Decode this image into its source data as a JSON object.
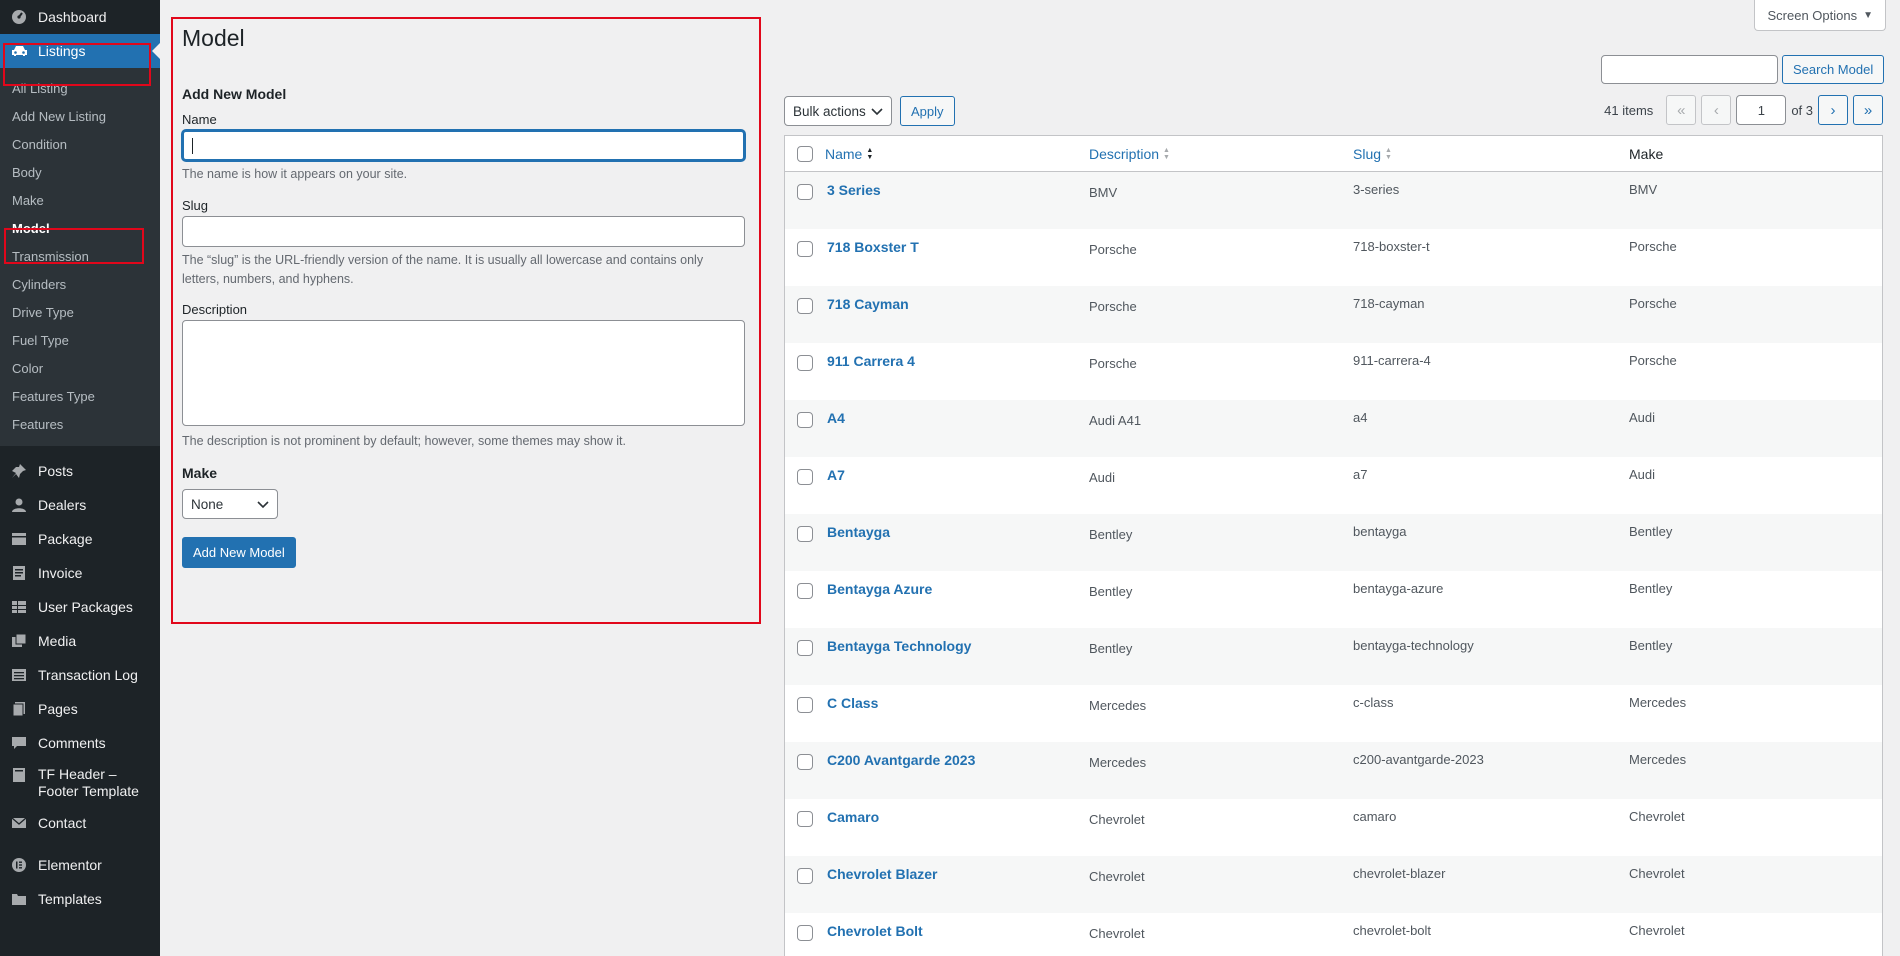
{
  "sidebar": {
    "top_items": [
      {
        "label": "Dashboard",
        "icon": "dashboard-icon"
      },
      {
        "label": "Listings",
        "icon": "car-icon"
      }
    ],
    "submenu": [
      "All Listing",
      "Add New Listing",
      "Condition",
      "Body",
      "Make",
      "Model",
      "Transmission",
      "Cylinders",
      "Drive Type",
      "Fuel Type",
      "Color",
      "Features Type",
      "Features"
    ],
    "bottom_items": [
      {
        "label": "Posts",
        "icon": "pin-icon"
      },
      {
        "label": "Dealers",
        "icon": "user-icon"
      },
      {
        "label": "Package",
        "icon": "package-icon"
      },
      {
        "label": "Invoice",
        "icon": "invoice-icon"
      },
      {
        "label": "User Packages",
        "icon": "table-icon"
      },
      {
        "label": "Media",
        "icon": "media-icon"
      },
      {
        "label": "Transaction Log",
        "icon": "list-icon"
      },
      {
        "label": "Pages",
        "icon": "pages-icon"
      },
      {
        "label": "Comments",
        "icon": "comment-icon"
      },
      {
        "label": "TF Header – Footer Template",
        "icon": "template-icon"
      },
      {
        "label": "Contact",
        "icon": "mail-icon"
      },
      {
        "label": "Elementor",
        "icon": "elementor-icon"
      },
      {
        "label": "Templates",
        "icon": "folder-icon"
      }
    ]
  },
  "screen_options": "Screen Options",
  "form": {
    "page_title": "Model",
    "heading": "Add New Model",
    "name_label": "Name",
    "name_help": "The name is how it appears on your site.",
    "slug_label": "Slug",
    "slug_help": "The “slug” is the URL-friendly version of the name. It is usually all lowercase and contains only letters, numbers, and hyphens.",
    "desc_label": "Description",
    "desc_help": "The description is not prominent by default; however, some themes may show it.",
    "make_label": "Make",
    "make_value": "None",
    "submit": "Add New Model"
  },
  "search_button": "Search Model",
  "bulk_actions": "Bulk actions",
  "apply": "Apply",
  "pagination": {
    "items": "41 items",
    "first": "«",
    "prev": "‹",
    "current": "1",
    "of": "of 3",
    "next": "›",
    "last": "»"
  },
  "table": {
    "columns": {
      "name": "Name",
      "description": "Description",
      "slug": "Slug",
      "make": "Make"
    },
    "rows": [
      {
        "name": "3 Series",
        "description": "BMV",
        "slug": "3-series",
        "make": "BMV"
      },
      {
        "name": "718 Boxster T",
        "description": "Porsche",
        "slug": "718-boxster-t",
        "make": "Porsche"
      },
      {
        "name": "718 Cayman",
        "description": "Porsche",
        "slug": "718-cayman",
        "make": "Porsche"
      },
      {
        "name": "911 Carrera 4",
        "description": "Porsche",
        "slug": "911-carrera-4",
        "make": "Porsche"
      },
      {
        "name": "A4",
        "description": "Audi A41",
        "slug": "a4",
        "make": "Audi"
      },
      {
        "name": "A7",
        "description": "Audi",
        "slug": "a7",
        "make": "Audi"
      },
      {
        "name": "Bentayga",
        "description": "Bentley",
        "slug": "bentayga",
        "make": "Bentley"
      },
      {
        "name": "Bentayga Azure",
        "description": "Bentley",
        "slug": "bentayga-azure",
        "make": "Bentley"
      },
      {
        "name": "Bentayga Technology",
        "description": "Bentley",
        "slug": "bentayga-technology",
        "make": "Bentley"
      },
      {
        "name": "C Class",
        "description": "Mercedes",
        "slug": "c-class",
        "make": "Mercedes"
      },
      {
        "name": "C200 Avantgarde 2023",
        "description": "Mercedes",
        "slug": "c200-avantgarde-2023",
        "make": "Mercedes"
      },
      {
        "name": "Camaro",
        "description": "Chevrolet",
        "slug": "camaro",
        "make": "Chevrolet"
      },
      {
        "name": "Chevrolet Blazer",
        "description": "Chevrolet",
        "slug": "chevrolet-blazer",
        "make": "Chevrolet"
      },
      {
        "name": "Chevrolet Bolt",
        "description": "Chevrolet",
        "slug": "chevrolet-bolt",
        "make": "Chevrolet"
      }
    ]
  },
  "colors": {
    "accent": "#2271b1",
    "sidebar": "#1d2327",
    "highlight": "#e1071b"
  }
}
